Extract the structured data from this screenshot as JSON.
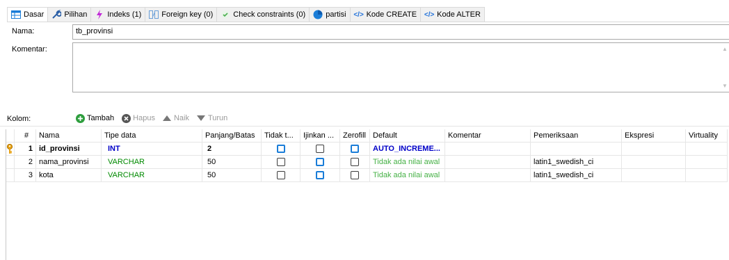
{
  "tabs": [
    {
      "label": "Dasar",
      "icon": "table-icon"
    },
    {
      "label": "Pilihan",
      "icon": "wrench-icon"
    },
    {
      "label": "Indeks (1)",
      "icon": "lightning-icon"
    },
    {
      "label": "Foreign key (0)",
      "icon": "foreign-key-icon"
    },
    {
      "label": "Check constraints (0)",
      "icon": "check-icon"
    },
    {
      "label": "partisi",
      "icon": "pie-icon"
    },
    {
      "label": "Kode CREATE",
      "icon": "code-icon"
    },
    {
      "label": "Kode ALTER",
      "icon": "code-icon"
    }
  ],
  "code_icon_text": "</>",
  "form": {
    "nama_label": "Nama:",
    "nama_value": "tb_provinsi",
    "komentar_label": "Komentar:",
    "komentar_value": ""
  },
  "toolbar": {
    "kolom_label": "Kolom:",
    "tambah": "Tambah",
    "hapus": "Hapus",
    "naik": "Naik",
    "turun": "Turun"
  },
  "grid": {
    "headers": [
      "#",
      "Nama",
      "Tipe data",
      "Panjang/Batas",
      "Tidak t...",
      "Ijinkan ...",
      "Zerofill",
      "Default",
      "Komentar",
      "Pemeriksaan",
      "Ekspresi",
      "Virtuality"
    ],
    "rows": [
      {
        "num": "1",
        "nama": "id_provinsi",
        "tipe": "INT",
        "panjang": "2",
        "default": "AUTO_INCREME...",
        "komentar": "",
        "pemeriksaan": "",
        "ekspresi": "",
        "virtuality": ""
      },
      {
        "num": "2",
        "nama": "nama_provinsi",
        "tipe": "VARCHAR",
        "panjang": "50",
        "default": "Tidak ada nilai awal",
        "komentar": "",
        "pemeriksaan": "latin1_swedish_ci",
        "ekspresi": "",
        "virtuality": ""
      },
      {
        "num": "3",
        "nama": "kota",
        "tipe": "VARCHAR",
        "panjang": "50",
        "default": "Tidak ada nilai awal",
        "komentar": "",
        "pemeriksaan": "latin1_swedish_ci",
        "ekspresi": "",
        "virtuality": ""
      }
    ]
  },
  "colors": {
    "accent": "#1a7dd8",
    "int_type": "#0000c8",
    "varchar_type": "#008a00",
    "default_none": "#46b146",
    "key": "#e8a317"
  }
}
